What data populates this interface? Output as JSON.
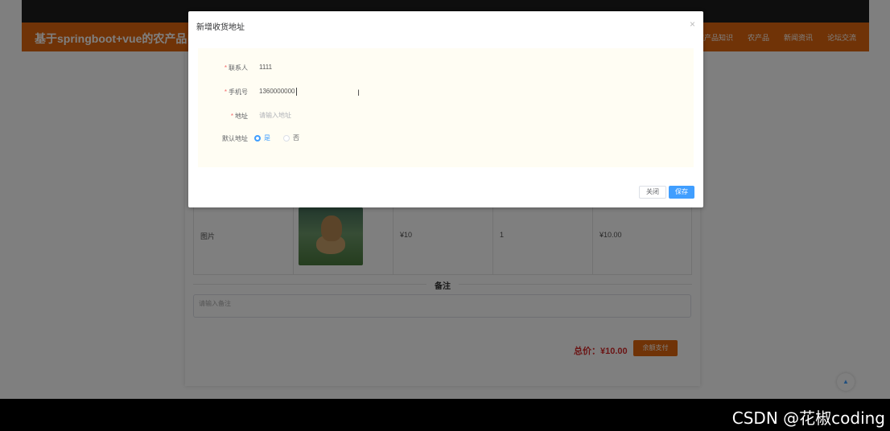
{
  "header": {
    "topbar_text": "",
    "brand": "基于springboot+vue的农产品电商",
    "nav": [
      "农产品知识",
      "农产品",
      "新闻资讯",
      "论坛交流"
    ]
  },
  "cart": {
    "product_name": "图片",
    "price": "¥10",
    "quantity": "1",
    "subtotal": "¥10.00"
  },
  "remark": {
    "title": "备注",
    "placeholder": "请输入备注"
  },
  "summary": {
    "total": "总价：¥10.00",
    "pay_button": "余额支付"
  },
  "dialog": {
    "title": "新增收货地址",
    "close_symbol": "×",
    "fields": {
      "contact": {
        "label": "联系人",
        "value": "1111"
      },
      "phone": {
        "label": "手机号",
        "value": "1360000000"
      },
      "address": {
        "label": "地址",
        "placeholder": "请输入地址"
      },
      "default": {
        "label": "默认地址",
        "options": [
          "是",
          "否"
        ],
        "selected": "是"
      }
    },
    "buttons": {
      "close": "关闭",
      "save": "保存"
    }
  },
  "watermark": "CSDN @花椒coding",
  "colors": {
    "brand": "#e0670e",
    "primary": "#409eff",
    "danger": "#d62b2b"
  }
}
